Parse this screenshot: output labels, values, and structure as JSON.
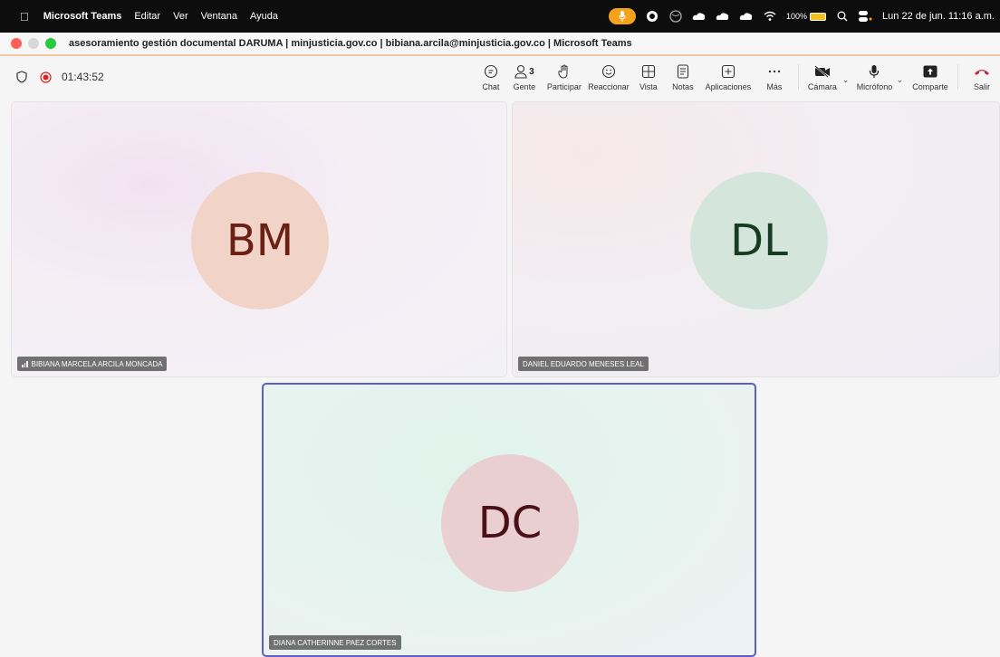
{
  "menubar": {
    "app_name": "Microsoft Teams",
    "menus": [
      "Editar",
      "Ver",
      "Ventana",
      "Ayuda"
    ],
    "battery_text": "100%",
    "datetime": "Lun 22 de jun.  11:16 a.m.",
    "mic_active_color": "#f6a21a"
  },
  "window": {
    "title": "asesoramiento gestión documental DARUMA | minjusticia.gov.co | bibiana.arcila@minjusticia.gov.co | Microsoft Teams"
  },
  "meeting": {
    "timer": "01:43:52",
    "record_color": "#e02020",
    "people_count": "3",
    "toolbar": {
      "chat": "Chat",
      "people": "Gente",
      "raise": "Participar",
      "react": "Reaccionar",
      "view": "Vista",
      "notes": "Notas",
      "apps": "Aplicaciones",
      "more": "Más",
      "camera": "Cámara",
      "mic": "Micrófono",
      "share": "Comparte",
      "leave": "Salir"
    },
    "leave_color": "#c4314b"
  },
  "participants": [
    {
      "initials": "BM",
      "name": "BIBIANA MARCELA ARCILA MONCADA",
      "avatar_bg": "#f1d3c8",
      "avatar_fg": "#6b2014"
    },
    {
      "initials": "DL",
      "name": "DANIEL EDUARDO MENESES LEAL",
      "avatar_bg": "#d4e6dc",
      "avatar_fg": "#173c24"
    },
    {
      "initials": "DC",
      "name": "DIANA CATHERINNE PAEZ CORTES",
      "avatar_bg": "#e9cfd2",
      "avatar_fg": "#4a0f17"
    }
  ],
  "active_speaker_color": "#5b5fc7"
}
